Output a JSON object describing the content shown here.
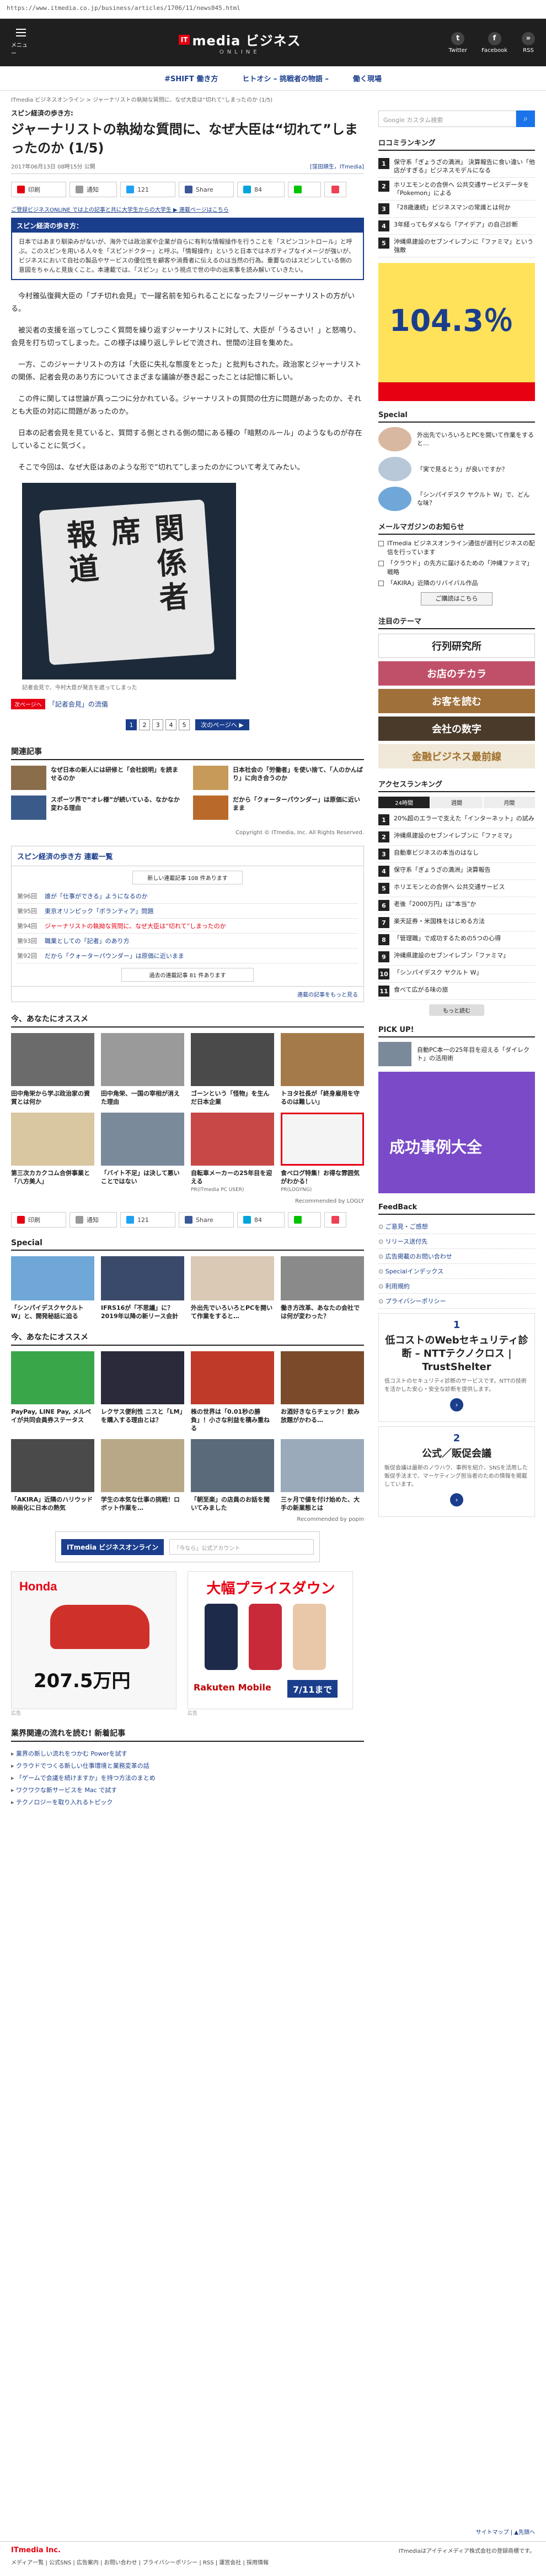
{
  "url": "https://www.itmedia.co.jp/business/articles/1706/11/news045.html",
  "header": {
    "menu_label": "メニュー",
    "logo_prefix": "IT",
    "logo_main": "media ビジネス",
    "logo_sub": "ONLINE",
    "icons": [
      {
        "label": "Twitter",
        "glyph": "t"
      },
      {
        "label": "Facebook",
        "glyph": "f"
      },
      {
        "label": "RSS",
        "glyph": "»"
      }
    ]
  },
  "tagnav": [
    "#SHIFT 働き方",
    "ヒトオシ – 挑戦者の物語 –",
    "働く現場"
  ],
  "breadcrumb": "ITmedia ビジネスオンライン > ジャーナリストの執拗な質問に、なぜ大臣は“切れて”しまったのか (1/5)",
  "article": {
    "series": "スピン経済の歩き方:",
    "title": "ジャーナリストの執拗な質問に、なぜ大臣は“切れて”しまったのか (1/5)",
    "date": "2017年06月13日 08時15分 公開",
    "author": "[窪田順生，ITmedia]",
    "share": {
      "print": "印刷",
      "bookmark": "通知",
      "tweet": "121",
      "share": "Share",
      "b": "84",
      "pocket": "•"
    },
    "notice": "ご登録ビジネスONLINE では上の記事と共に大学生からの大学生 ▶ 連載ページはこちら",
    "summary_title": "スピン経済の歩き方：",
    "summary": "日本ではあまり馴染みがないが、海外では政治家や企業が自らに有利な情報操作を行うことを「スピンコントロール」と呼ぶ。このスピンを用いる人々を「スピンドクター」と呼ぶ。「情報操作」というと日本ではネガティブなイメージが強いが、ビジネスにおいて自社の製品やサービスの優位性を顧客や消費者に伝えるのは当然の行為。重要なのはスピンしている側の意図をちゃんと見抜くこと。本連載では、「スピン」という視点で世の中の出来事を読み解いていきたい。",
    "paragraphs": [
      "今村雅弘復興大臣の「ブチ切れ会見」で一躍名前を知られることになったフリージャーナリストの方がいる。",
      "被災者の支援を巡ってしつこく質問を繰り返すジャーナリストに対して、大臣が「うるさい！」と怒鳴り、会見を打ち切ってしまった。この様子は繰り返しテレビで流され、世間の注目を集めた。",
      "一方、このジャーナリストの方は「大臣に失礼な態度をとった」と批判もされた。政治家とジャーナリストの関係、記者会見のあり方についてさまざまな議論が巻き起こったことは記憶に新しい。",
      "この件に関しては世論が真っ二つに分かれている。ジャーナリストの質問の仕方に問題があったのか、それとも大臣の対応に問題があったのか。",
      "日本の記者会見を見ていると、質問する側とされる側の間にある種の「暗黙のルール」のようなものが存在していることに気づく。",
      "そこで今回は、なぜ大臣はあのような形で“切れて”しまったのかについて考えてみたい。"
    ],
    "image_caption": "記者会見で、今村大臣が発言を遮ってしまった",
    "image_sign": [
      "報道",
      "関係者席"
    ],
    "next_tag": "次ページへ",
    "next_link": "「記者会見」の流儀",
    "pages": [
      "1",
      "2",
      "3",
      "4",
      "5"
    ],
    "next_btn": "次のページへ ▶"
  },
  "related": {
    "heading": "関連記事",
    "items": [
      "なぜ日本の新人には研修と「会社説明」を読ませるのか",
      "日本社会の「労働者」を使い捨て、「人のかんばり」に向き合うのか",
      "スポーツ界で“オレ様”が続いている、なかなか変わる理由",
      "だから「クォーターパウンダー」は原価に近いまま"
    ]
  },
  "copyright": "Copyright © ITmedia, Inc. All Rights Reserved.",
  "series_list": {
    "title": "スピン経済の歩き方 連載一覧",
    "new_btn": "新しい連載記事 108 件あります",
    "items": [
      {
        "num": "第96回",
        "t": "誰が「仕事ができる」ようになるのか",
        "cur": false
      },
      {
        "num": "第95回",
        "t": "東京オリンピック「ボランティア」問題",
        "cur": false
      },
      {
        "num": "第94回",
        "t": "ジャーナリストの執拗な質問に、なぜ大臣は“切れて”しまったのか",
        "cur": true
      },
      {
        "num": "第93回",
        "t": "職業としての「記者」のあり方",
        "cur": false
      },
      {
        "num": "第92回",
        "t": "だから「クォーターパウンダー」は原価に近いまま",
        "cur": false
      }
    ],
    "all_btn": "過去の連載記事 81 件あります",
    "foot": "連載の記事をもっと見る"
  },
  "recommend": {
    "heading": "今、あなたにオススメ",
    "items": [
      {
        "t": "田中角栄から学ぶ政治家の資質とは何か",
        "src": "",
        "ad": false
      },
      {
        "t": "田中角栄、一国の宰相が消えた理由",
        "src": "",
        "ad": false
      },
      {
        "t": "ゴーンという「怪物」を生んだ日本企業",
        "src": "",
        "ad": false
      },
      {
        "t": "トヨタ社長が「終身雇用を守るのは難しい」",
        "src": "",
        "ad": false
      },
      {
        "t": "第三次カカクコム合併事業と「八方美人」",
        "src": "",
        "ad": false
      },
      {
        "t": "「バイト不足」は決して悪いことではない",
        "src": "",
        "ad": false
      },
      {
        "t": "自転車メーカーの25年目を迎える",
        "src": "PR(ITmedia PC USER)",
        "ad": false
      },
      {
        "t": "食べログ特集！お得な雰囲気がわかる！",
        "src": "PR(LOGYNG)",
        "ad": true
      }
    ],
    "footer": "Recommended by LOGLY"
  },
  "special": {
    "heading": "Special",
    "items": [
      "「シンパイデスクヤクルト W」と、開発秘話に迫る",
      "IFRS16が「不思議」に？ 2019年以降の新リース会計",
      "外出先でいろいろとPCを開いて作業をすると…",
      "働き方改革、あなたの会社では何が変わった？"
    ]
  },
  "popin": {
    "heading": "今、あなたにオススメ",
    "items": [
      "PayPay, LINE Pay, メルペイが共同会員券ステータス",
      "レクサス便利性 ニスと「LM」を購入する理由とは？",
      "株の世界は「0.01秒の勝負」！小さな利益を積み重ねる",
      "お酒好きならチェック！飲み放題がかわる…",
      "「AKIRA」近隣のハリウッド映画化に日本の熱気",
      "学生の本気な仕事の挑戦！ロボット作業を…",
      "「朝至楽」の店員のお話を聞いてみました",
      "三ヶ月で値を付け始めた、大手の新業態とは"
    ],
    "footer": "Recommended by popin"
  },
  "bottom_banner": {
    "logo": "ITmedia ビジネスオンライン",
    "placeholder": "「今なら」公式アカウント"
  },
  "ads": {
    "honda": {
      "brand": "Honda",
      "price": "207.5万円",
      "label": "広告"
    },
    "rakuten": {
      "headline": "大幅プライスダウン",
      "brand": "Rakuten Mobile",
      "date": "7/11まで",
      "label": "広告"
    }
  },
  "news_links": {
    "heading": "業界関連の流れを読む! 新着記事",
    "items": [
      "業界の新しい流れをつかむ Powerを試す",
      "クラウドでつくる新しい仕事環境と業務変革の話",
      "「ゲームで会議を続けますか」を持つ方法のまとめ",
      "ワクワクな新サービスを Mac で試す",
      "テクノロジーを取り入れるトピック"
    ]
  },
  "sidebar": {
    "search_placeholder": "Google カスタム検索",
    "ranking_heading": "ロコミランキング",
    "ranking": [
      "保守系「ぎょうざの満洲」 決算報告に食い違い「他店がすぎる」ビジネスモデルになる",
      "ホリエモンとの合併へ 公共交通サービスデータを「Pokemon」による",
      "「28歳連続」ビジネスマンの常識とは何か",
      "3年経ってもダメなら「アイデア」の自己診断",
      "沖縄県建設のセブンイレブンに「ファミマ」という強敵"
    ],
    "ad_headline": "104.3％",
    "special_heading": "Special",
    "special": [
      "外出先でいろいろとPCを開いて作業をすると…",
      "「実で見るとう」が良いですか？",
      "「シンパイデスク ヤクルト W」で、どんな味？"
    ],
    "mail_heading": "メールマガジンのお知らせ",
    "mail_items": [
      "ITmedia ビジネスオンライン通信が週刊ビジネスの配信を行っています",
      "「クラウド」の先方に届けるための「沖縄ファミマ」戦略",
      "「AKIRA」近隣のリバイバル作品"
    ],
    "mail_cta": "ご購読はこちら",
    "themes_heading": "注目のテーマ",
    "themes": [
      "行列研究所",
      "お店のチカラ",
      "お客を読む",
      "会社の数字",
      "金融ビジネス最前線"
    ],
    "access_heading": "アクセスランキング",
    "access_tabs": [
      "24時間",
      "週間",
      "月間"
    ],
    "access": [
      "20%超のエラーで支えた「インターネット」の試み",
      "沖縄県建設のセブンイレブンに「ファミマ」",
      "自動車ビジネスの本当のはなし",
      "保守系「ぎょうざの満洲」決算報告",
      "ホリエモンとの合併へ 公共交通サービス",
      "老後「2000万円」は”本当”か",
      "楽天証券・米国株をはじめる方法",
      "「管理職」で成功するための5つの心得",
      "沖縄県建設のセブンイレブン「ファミマ」",
      "「シンパイデスク ヤクルト W」",
      "食べて広がる味の旅"
    ],
    "access_more": "もっと読む",
    "pickup_heading": "PICK UP!",
    "pickup_item": "自動PC本一の25年目を迎える「ダイレクト」の活用術",
    "pickup_ad": "成功事例大全",
    "feedback_heading": "FeedBack",
    "feedback": [
      "ご意見・ご感想",
      "リリース送付先",
      "広告掲載のお問い合わせ",
      "Specialインデックス",
      "利用規約",
      "プライバシーポリシー"
    ],
    "trusted_num": "1",
    "trusted_head": "低コストのWebセキュリティ診断 – NTTテクノクロス | TrustShelter",
    "trusted_desc": "低コストのセキュリティ診断のサービスです。NTTの技術を活かした安心・安全な診断を提供します。",
    "pr_num": "2",
    "pr_head": "公式／販促会議",
    "pr_desc": "販促会議は最新のノウハウ、事例を紹介、SNSを活用した販促手法まで、マーケティング担当者のための情報を掲載しています。"
  },
  "footer": {
    "company": "ITmedia Inc.",
    "text": "ITmediaはアイティメディア株式会社の登録商標です。",
    "links": "メディア一覧 | 公式SNS | 広告案内 | お問い合わせ | プライバシーポリシー | RSS | 運営会社 | 採用情報",
    "top_link": "サイトマップ | ▲先頭へ"
  }
}
